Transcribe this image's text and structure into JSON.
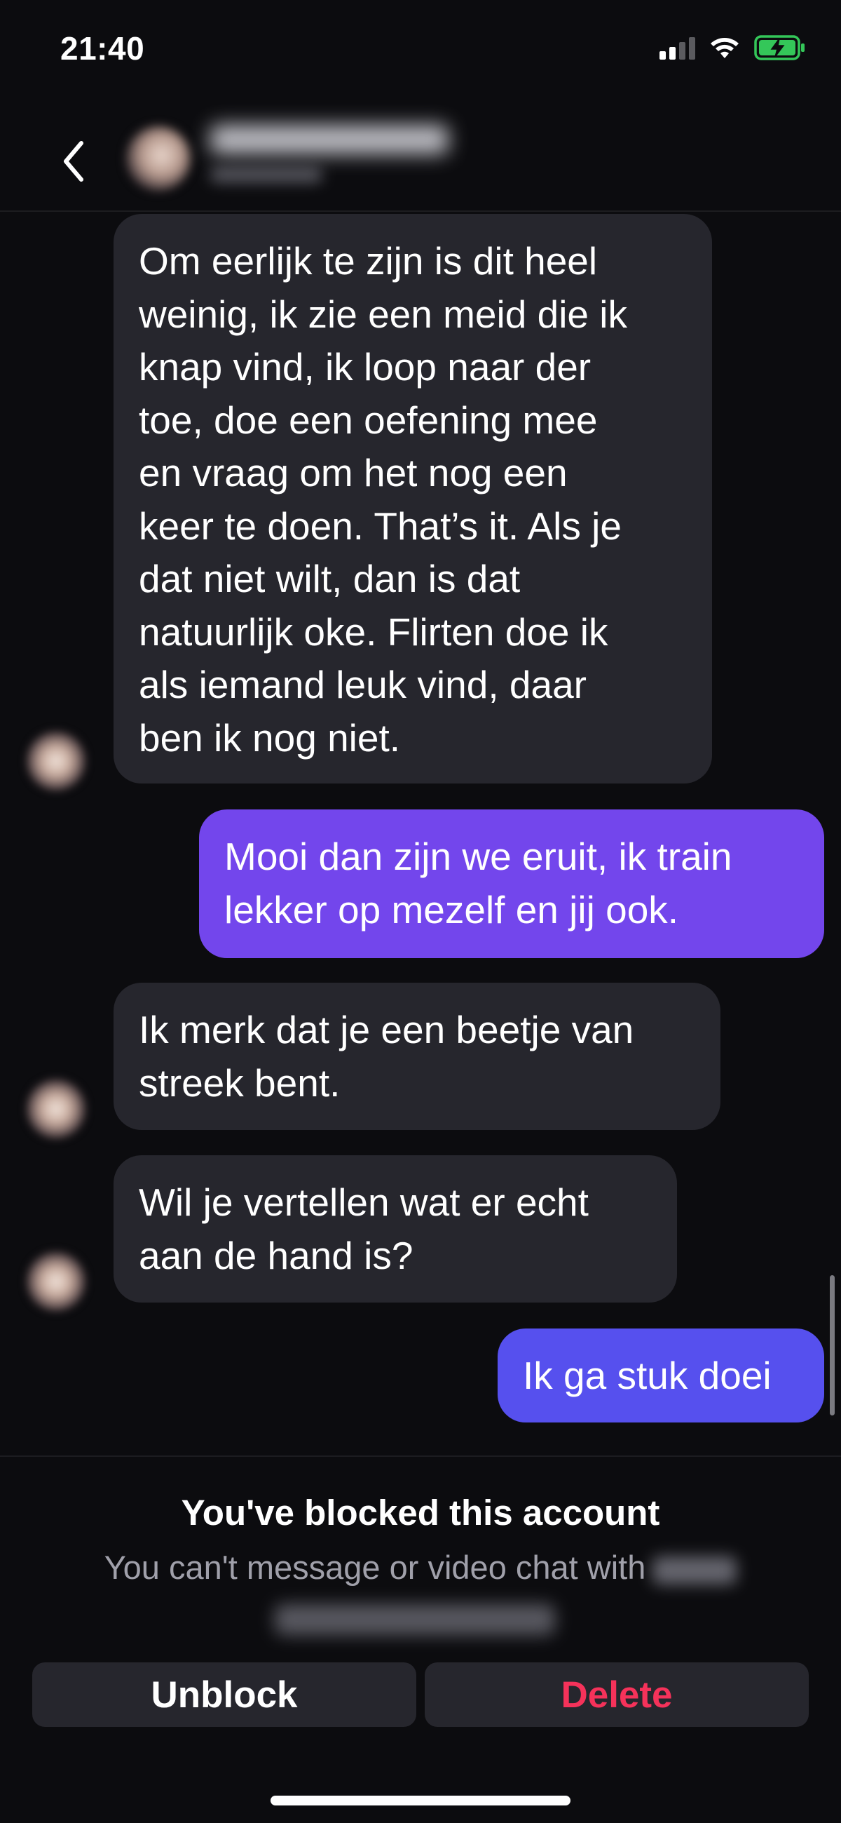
{
  "status_bar": {
    "time": "21:40",
    "signal_icon": "cellular-signal-icon",
    "wifi_icon": "wifi-icon",
    "battery_icon": "battery-charging-icon",
    "battery_color": "#34c759"
  },
  "header": {
    "back_icon": "chevron-left-icon"
  },
  "messages": [
    {
      "direction": "in",
      "lines": [
        "Om eerlijk te zijn is dit heel",
        "weinig, ik zie een meid die ik",
        "knap vind, ik loop naar der",
        "toe, doe een oefening mee",
        "en vraag om het nog een",
        "keer te doen. That’s it. Als je",
        "dat niet wilt, dan is dat",
        "natuurlijk oke. Flirten doe ik",
        "als iemand leuk vind, daar",
        "ben ik nog niet."
      ]
    },
    {
      "direction": "out",
      "lines": [
        "Mooi dan zijn we eruit, ik train",
        "lekker op mezelf en jij ook."
      ],
      "color": "#7a46ee"
    },
    {
      "direction": "in",
      "lines": [
        "Ik merk dat je een beetje van",
        "streek bent."
      ]
    },
    {
      "direction": "in",
      "lines": [
        "Wil je vertellen wat er echt",
        "aan de hand is?"
      ]
    },
    {
      "direction": "out",
      "lines": [
        "Ik ga stuk doei"
      ],
      "color": "#5a50ee"
    }
  ],
  "blocked": {
    "title": "You've blocked this account",
    "subtitle": "You can't message or video chat with"
  },
  "actions": {
    "unblock_label": "Unblock",
    "delete_label": "Delete",
    "delete_color": "#f5325a"
  }
}
